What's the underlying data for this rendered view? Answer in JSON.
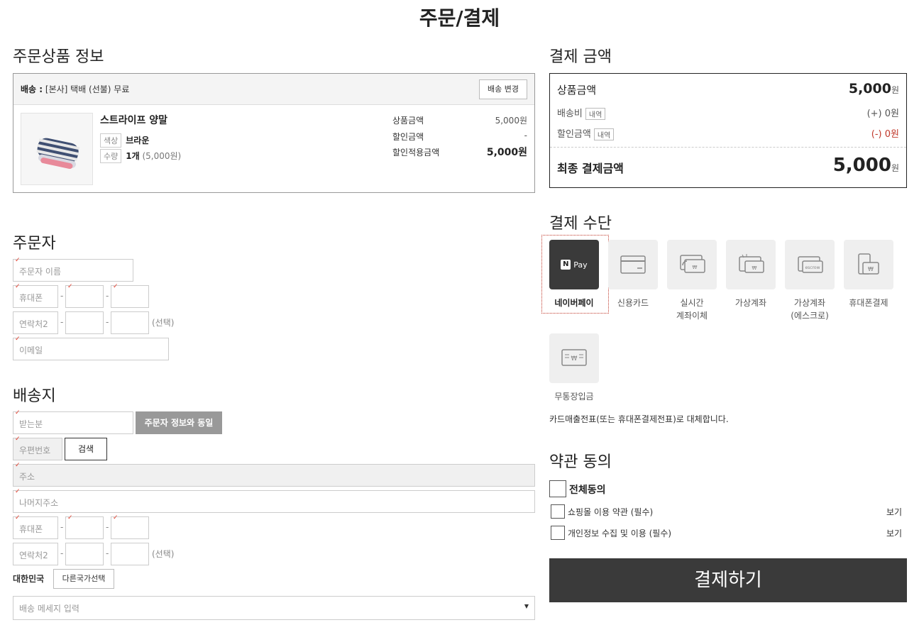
{
  "page_title": "주문/결제",
  "order_items": {
    "title": "주문상품 정보",
    "shipping_label": "배송 :",
    "shipping_text": "[본사] 택배 (선불) 무료",
    "change_shipping_button": "배송 변경",
    "product": {
      "name": "스트라이프 양말",
      "color_tag": "색상",
      "color_value": "브라운",
      "qty_tag": "수량",
      "qty_value": "1개",
      "qty_sub": "(5,000원)",
      "price_label": "상품금액",
      "price_value": "5,000원",
      "discount_label": "할인금액",
      "discount_value": "-",
      "final_label": "할인적용금액",
      "final_value": "5,000원"
    }
  },
  "orderer": {
    "title": "주문자",
    "name_placeholder": "주문자 이름",
    "phone_placeholder": "휴대폰",
    "contact2_placeholder": "연락처2",
    "optional_note": "(선택)",
    "email_placeholder": "이메일",
    "dash": "-"
  },
  "shipping": {
    "title": "배송지",
    "recipient_placeholder": "받는분",
    "same_as_orderer_button": "주문자 정보와 동일",
    "zip_placeholder": "우편번호",
    "search_button": "검색",
    "address_placeholder": "주소",
    "address_detail_placeholder": "나머지주소",
    "phone_placeholder": "휴대폰",
    "contact2_placeholder": "연락처2",
    "optional_note": "(선택)",
    "country": "대한민국",
    "other_country_button": "다른국가선택",
    "message_placeholder": "배송 메세지 입력"
  },
  "payment_amount": {
    "title": "결제 금액",
    "product_label": "상품금액",
    "product_value": "5,000",
    "won": "원",
    "shipping_label": "배송비",
    "detail_tag": "내역",
    "shipping_value": "(+) 0원",
    "discount_label": "할인금액",
    "discount_value": "(-) 0원",
    "final_label": "최종 결제금액",
    "final_value": "5,000",
    "discount_color": "#c0392b"
  },
  "payment_method": {
    "title": "결제 수단",
    "methods": [
      {
        "label": "네이버페이",
        "icon": "naver-pay-icon",
        "selected": true,
        "badge_n": "N",
        "badge_pay": "Pay"
      },
      {
        "label": "신용카드",
        "icon": "credit-card-icon"
      },
      {
        "label1": "실시간",
        "label2": "계좌이체",
        "icon": "bank-transfer-icon"
      },
      {
        "label": "가상계좌",
        "icon": "virtual-account-icon"
      },
      {
        "label1": "가상계좌",
        "label2": "(에스크로)",
        "icon": "escrow-icon",
        "badge": "escrow"
      },
      {
        "label": "휴대폰결제",
        "icon": "mobile-payment-icon"
      },
      {
        "label": "무통장입금",
        "icon": "bank-deposit-icon"
      }
    ],
    "receipt_note": "카드매출전표(또는 휴대폰결제전표)로 대체합니다."
  },
  "terms": {
    "title": "약관 동의",
    "agree_all": "전체동의",
    "items": [
      {
        "label": "쇼핑몰 이용 약관 (필수)",
        "view": "보기"
      },
      {
        "label": "개인정보 수집 및 이용 (필수)",
        "view": "보기"
      }
    ]
  },
  "pay_button": "결제하기"
}
